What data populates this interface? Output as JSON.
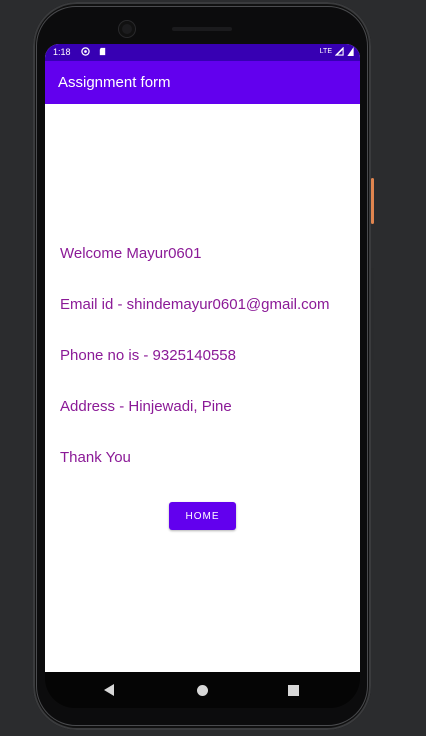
{
  "status_bar": {
    "time": "1:18",
    "network": "LTE"
  },
  "app_bar": {
    "title": "Assignment form"
  },
  "content": {
    "welcome": "Welcome Mayur0601",
    "email": "Email id - shindemayur0601@gmail.com",
    "phone": "Phone no is - 9325140558",
    "address": "Address - Hinjewadi, Pine",
    "thanks": "Thank You"
  },
  "home_button": {
    "label": "HOME"
  },
  "colors": {
    "status_bar": "#3700b3",
    "app_bar": "#6200ee",
    "text": "#8b1a97",
    "button": "#6200ee"
  },
  "icons": {
    "status": [
      "data-saver-icon",
      "sd-card-icon",
      "signal-icon",
      "battery-icon"
    ],
    "navigation": [
      "back-icon",
      "home-icon",
      "recents-icon"
    ]
  }
}
